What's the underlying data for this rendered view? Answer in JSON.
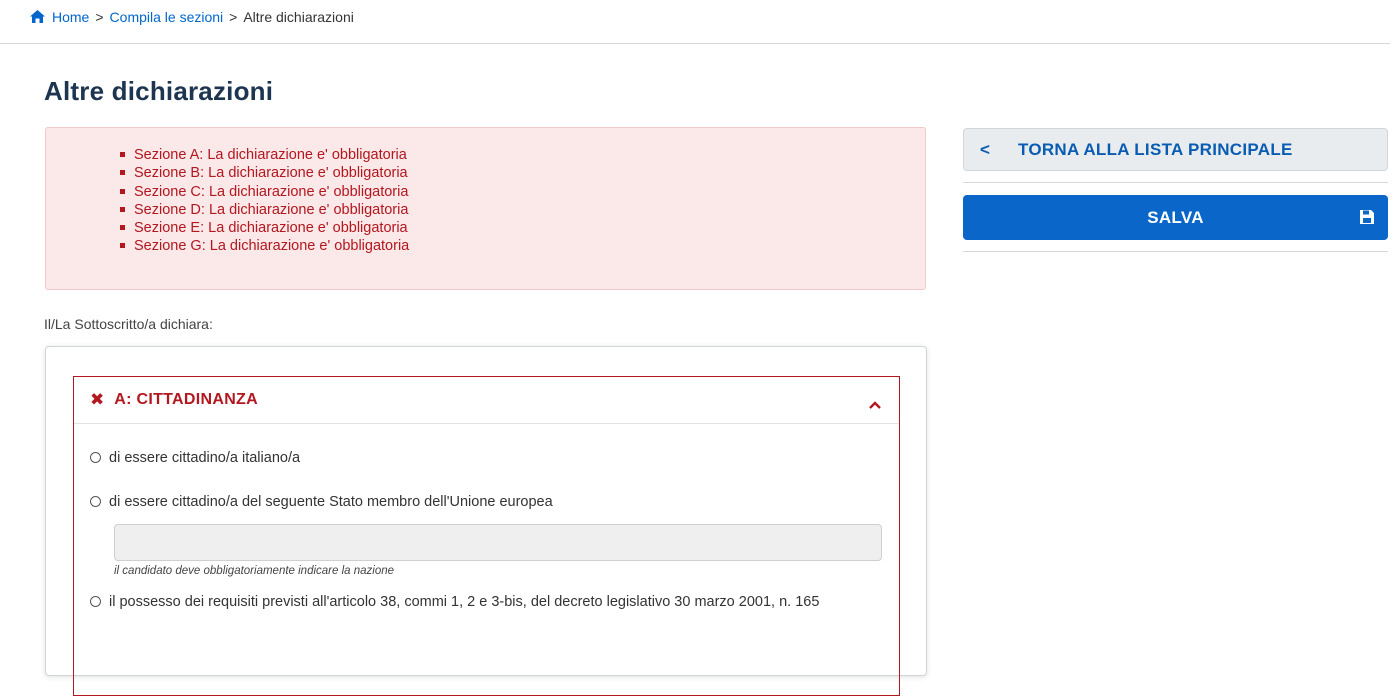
{
  "breadcrumb": {
    "home": "Home",
    "sep": ">",
    "sections": "Compila le sezioni",
    "current": "Altre dichiarazioni"
  },
  "page": {
    "title": "Altre dichiarazioni"
  },
  "errors": [
    "Sezione A: La dichiarazione e' obbligatoria",
    "Sezione B: La dichiarazione e' obbligatoria",
    "Sezione C: La dichiarazione e' obbligatoria",
    "Sezione D: La dichiarazione e' obbligatoria",
    "Sezione E: La dichiarazione e' obbligatoria",
    "Sezione G: La dichiarazione e' obbligatoria"
  ],
  "intro": "Il/La Sottoscritto/a dichiara:",
  "section_a": {
    "title": "A: CITTADINANZA",
    "options": [
      "di essere cittadino/a italiano/a",
      "di essere cittadino/a del seguente Stato membro dell'Unione europea",
      "il possesso dei requisiti previsti all'articolo 38, commi 1, 2 e 3-bis, del decreto legislativo 30 marzo 2001, n. 165"
    ],
    "nation_value": "",
    "nation_hint": "il candidato deve obbligatoriamente indicare la nazione"
  },
  "actions": {
    "back_label": "TORNA ALLA LISTA PRINCIPALE",
    "save_label": "SALVA"
  },
  "colors": {
    "error": "#b3171f",
    "primary": "#0a66c9",
    "title": "#1d3550"
  }
}
